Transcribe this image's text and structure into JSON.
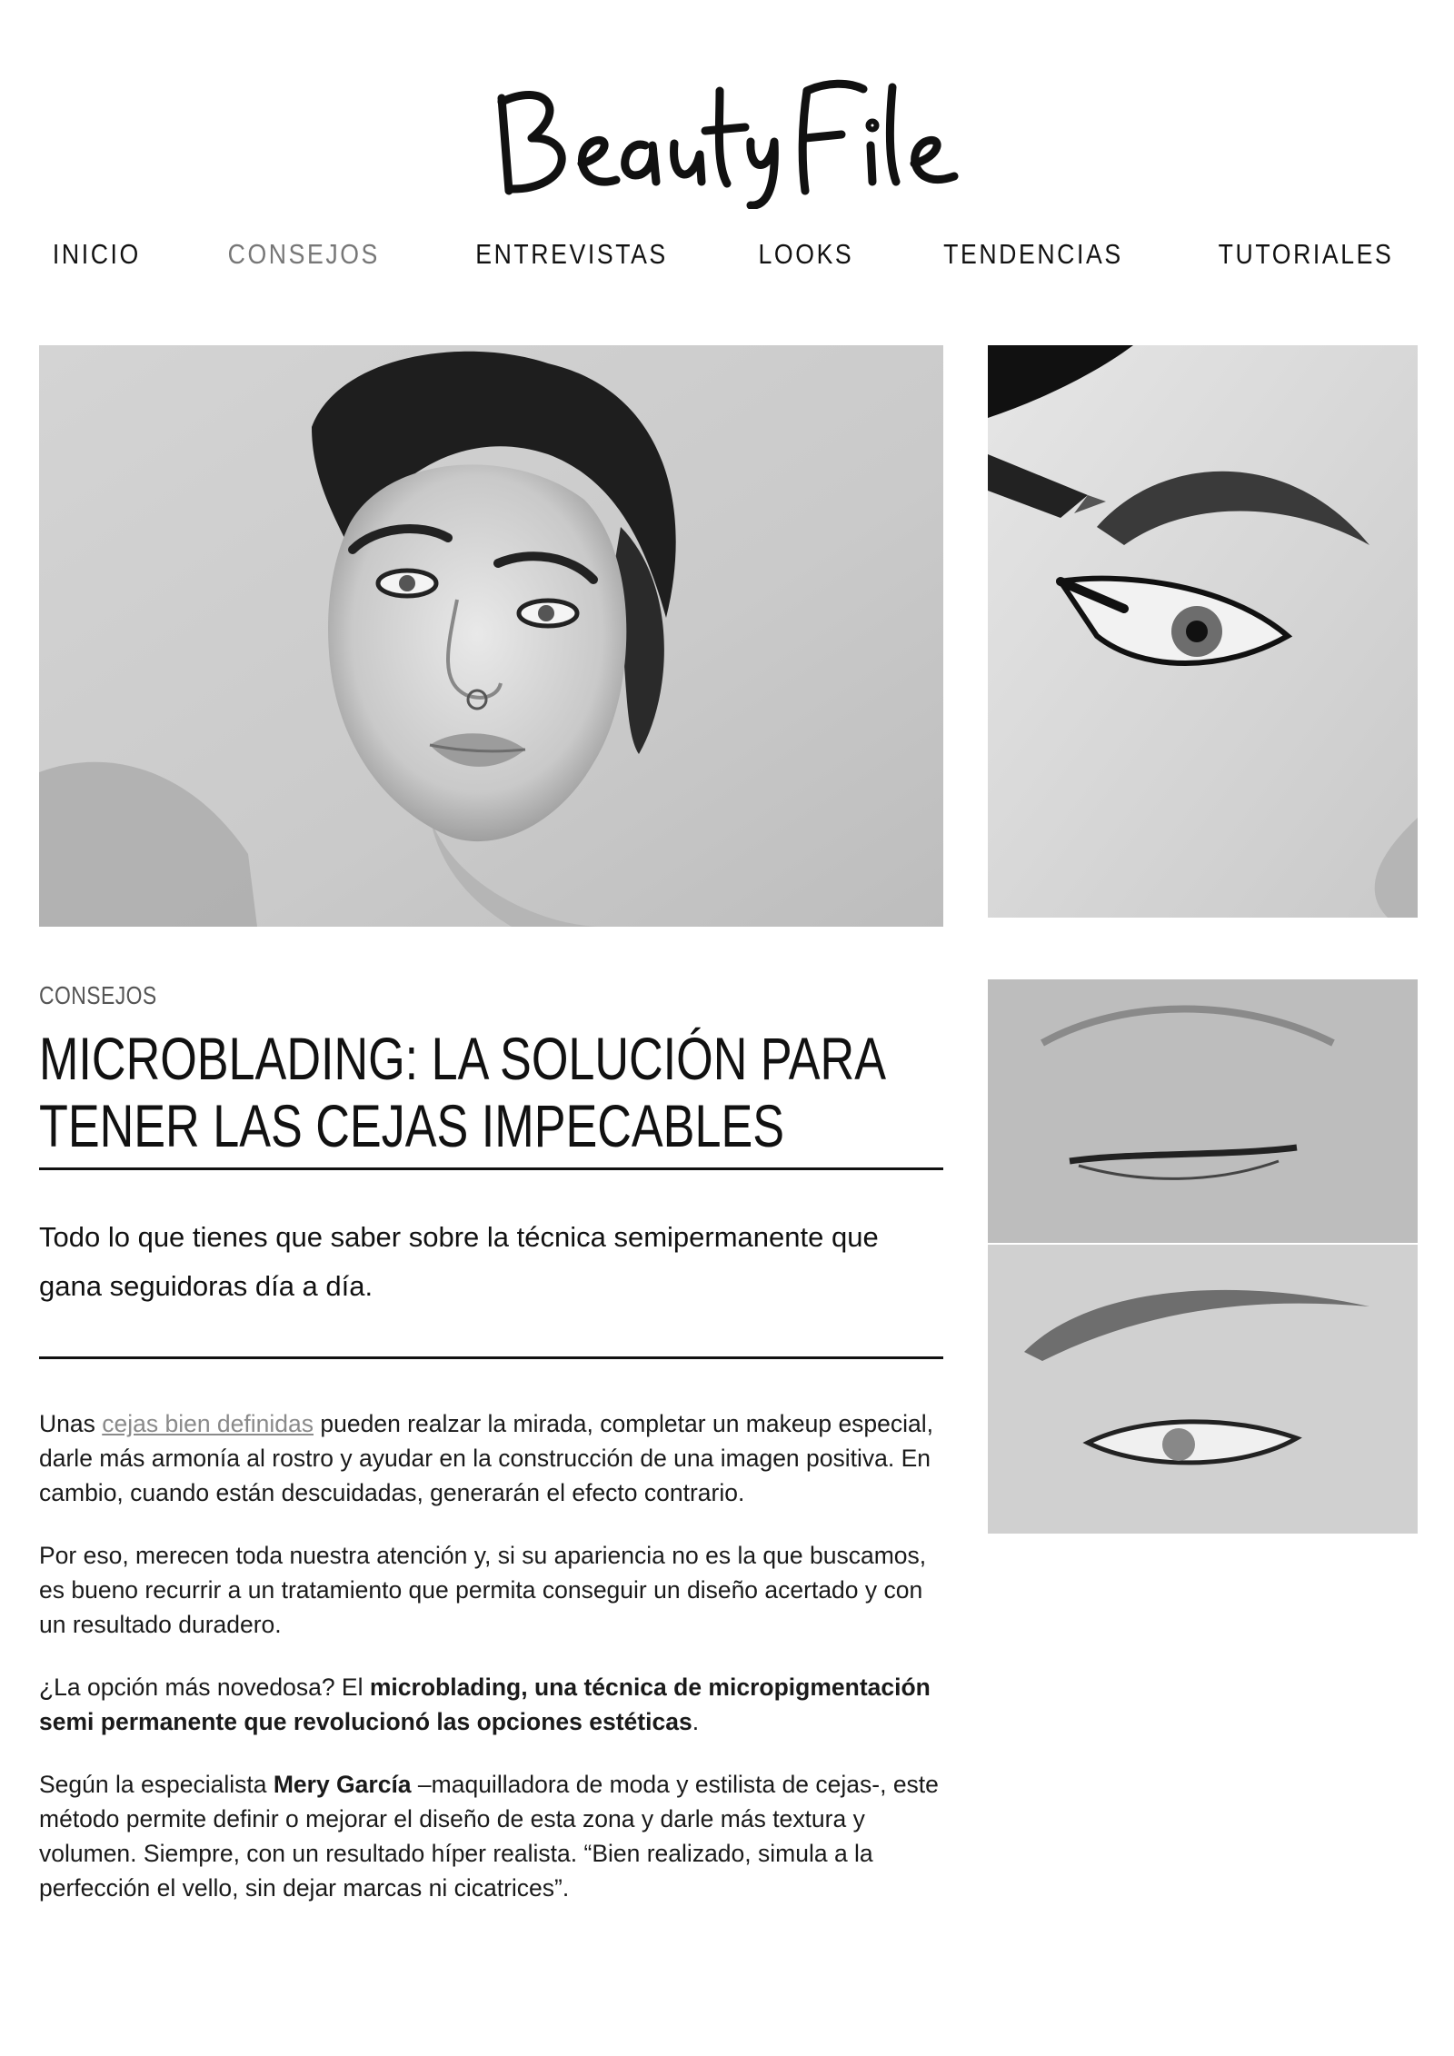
{
  "site": {
    "logo_text": "BeautyFile"
  },
  "nav": {
    "items": [
      {
        "label": "INICIO"
      },
      {
        "label": "CONSEJOS",
        "active": true
      },
      {
        "label": "ENTREVISTAS"
      },
      {
        "label": "LOOKS"
      },
      {
        "label": "TENDENCIAS"
      },
      {
        "label": "TUTORIALES"
      }
    ]
  },
  "article": {
    "category": "CONSEJOS",
    "title_line1": "MICROBLADING: LA SOLUCIÓN PARA",
    "title_line2": "TENER LAS CEJAS IMPECABLES",
    "subtitle": "Todo lo que tienes que saber sobre la técnica semipermanente que gana seguidoras día a día.",
    "p1_before_link": "Unas ",
    "p1_link": "cejas bien definidas",
    "p1_after_link": " pueden realzar la mirada, completar un makeup especial, darle más armonía al rostro y ayudar en la construcción de una imagen positiva. En cambio, cuando están descuidadas, generarán el efecto contrario.",
    "p2": "Por eso, merecen toda nuestra atención y, si su apariencia no es la que buscamos, es bueno recurrir a un tratamiento que permita conseguir un diseño acertado y con un resultado duradero.",
    "p3_before": "¿La opción más novedosa? El ",
    "p3_bold1": "microblading",
    "p3_mid": ", ",
    "p3_bold2": "una técnica de micropigmentación semi permanente que revolucionó las opciones estéticas",
    "p3_after": ".",
    "p4_before": "Según la especialista ",
    "p4_bold": "Mery García",
    "p4_after": " –maquilladora de moda y estilista de cejas-, este método permite definir o mejorar el diseño de esta zona y darle más textura y volumen. Siempre, con un resultado híper realista. “Bien realizado, simula a la perfección el vello, sin dejar marcas ni cicatrices”."
  },
  "colors": {
    "text": "#111111",
    "nav_active": "#777777",
    "link": "#8a8a8a",
    "background": "#ffffff"
  },
  "images": {
    "hero": "portrait-photo",
    "side_top": "eyeliner-eyebrow-photo",
    "side_bottom": "microblading-before-after-photo"
  }
}
